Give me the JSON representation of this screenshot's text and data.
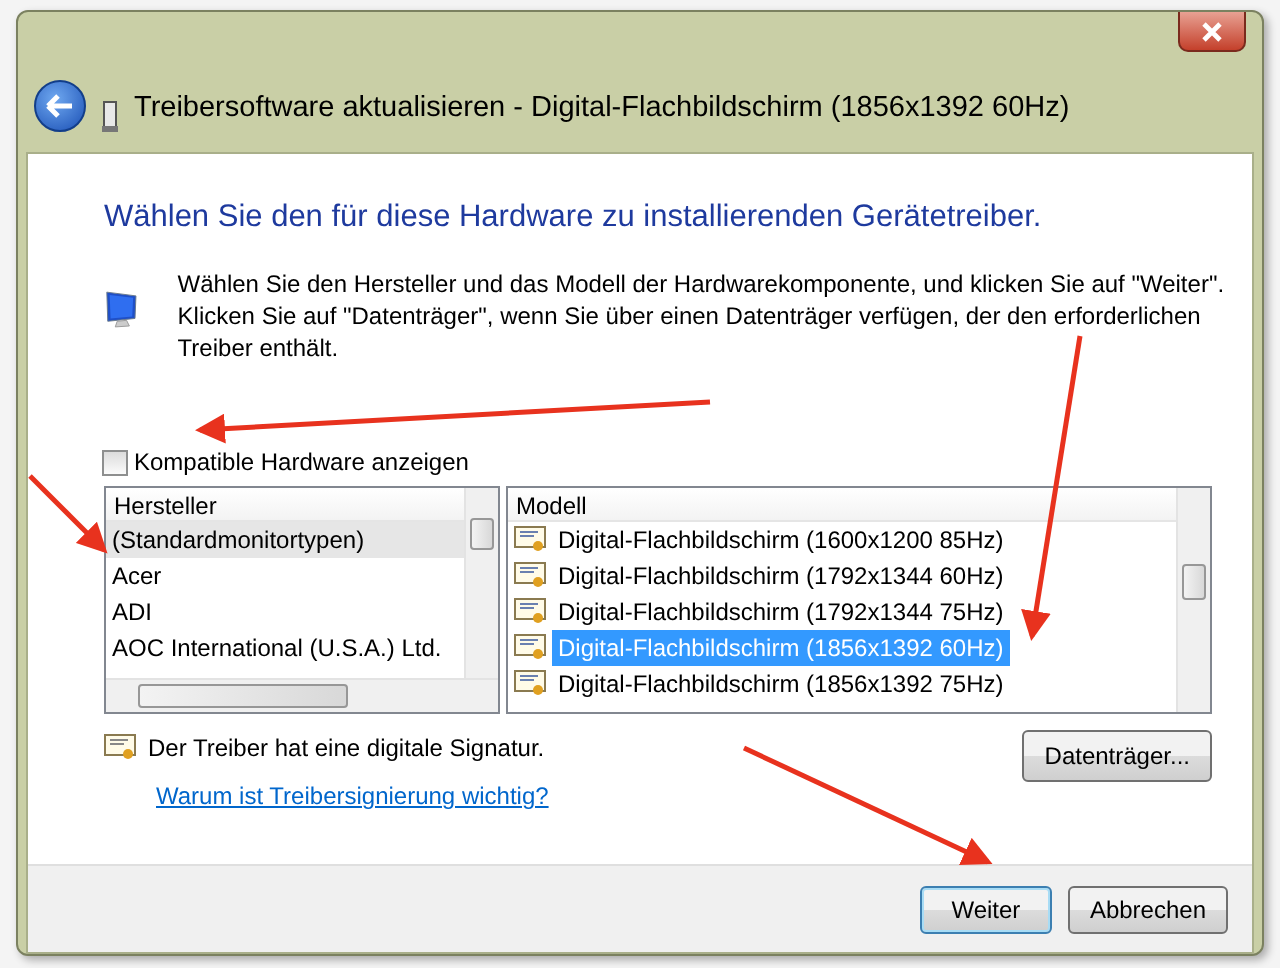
{
  "window": {
    "title": "Treibersoftware aktualisieren - Digital-Flachbildschirm (1856x1392 60Hz)"
  },
  "heading": "Wählen Sie den für diese Hardware zu installierenden Gerätetreiber.",
  "instructions": "Wählen Sie den Hersteller und das Modell der Hardwarekomponente, und klicken Sie auf \"Weiter\". Klicken Sie auf \"Datenträger\", wenn Sie über einen Datenträger verfügen, der den erforderlichen Treiber enthält.",
  "compatible_hardware": {
    "label": "Kompatible Hardware anzeigen",
    "checked": false
  },
  "manufacturers": {
    "header": "Hersteller",
    "items": [
      {
        "label": "(Standardmonitortypen)",
        "selected": true
      },
      {
        "label": "Acer",
        "selected": false
      },
      {
        "label": "ADI",
        "selected": false
      },
      {
        "label": "AOC International (U.S.A.) Ltd.",
        "selected": false
      }
    ]
  },
  "models": {
    "header": "Modell",
    "items": [
      {
        "label": "Digital-Flachbildschirm (1600x1200 85Hz)",
        "selected": false
      },
      {
        "label": "Digital-Flachbildschirm (1792x1344 60Hz)",
        "selected": false
      },
      {
        "label": "Digital-Flachbildschirm (1792x1344 75Hz)",
        "selected": false
      },
      {
        "label": "Digital-Flachbildschirm (1856x1392 60Hz)",
        "selected": true
      },
      {
        "label": "Digital-Flachbildschirm (1856x1392 75Hz)",
        "selected": false
      }
    ]
  },
  "signature": {
    "text": "Der Treiber hat eine digitale Signatur."
  },
  "link": "Warum ist Treibersignierung wichtig?",
  "disk_button": "Datenträger...",
  "buttons": [
    {
      "label": "Weiter",
      "default": true
    },
    {
      "label": "Abbrechen",
      "default": false
    }
  ]
}
